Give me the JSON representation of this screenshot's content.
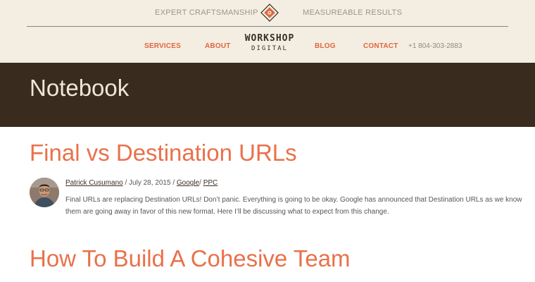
{
  "header": {
    "tagline_left": "EXPERT CRAFTSMANSHIP",
    "tagline_right": "MEASUREABLE RESULTS",
    "logo_line1": "WORKSHOP",
    "logo_line2": "DIGITAL",
    "phone": "+1 804-303-2883",
    "nav": {
      "services": "SERVICES",
      "about": "ABOUT",
      "blog": "BLOG",
      "contact": "CONTACT"
    }
  },
  "hero": {
    "title": "Notebook"
  },
  "posts": [
    {
      "title": "Final vs Destination URLs",
      "author": "Patrick Cusumano",
      "date": "July 28, 2015",
      "sep1": " / ",
      "sep2": " / ",
      "category1": "Google",
      "sep3": "/ ",
      "category2": "PPC",
      "excerpt": "Final URLs are replacing Destination URLs! Don’t panic. Everything is going to be okay. Google has announced that Destination URLs as we know them are going away in favor of this new format. Here I’ll be discussing what to expect from this change."
    },
    {
      "title": "How To Build A Cohesive Team"
    }
  ],
  "colors": {
    "accent": "#e9714a",
    "hero_bg": "#3a2b1f",
    "header_bg": "#f4ede1"
  }
}
